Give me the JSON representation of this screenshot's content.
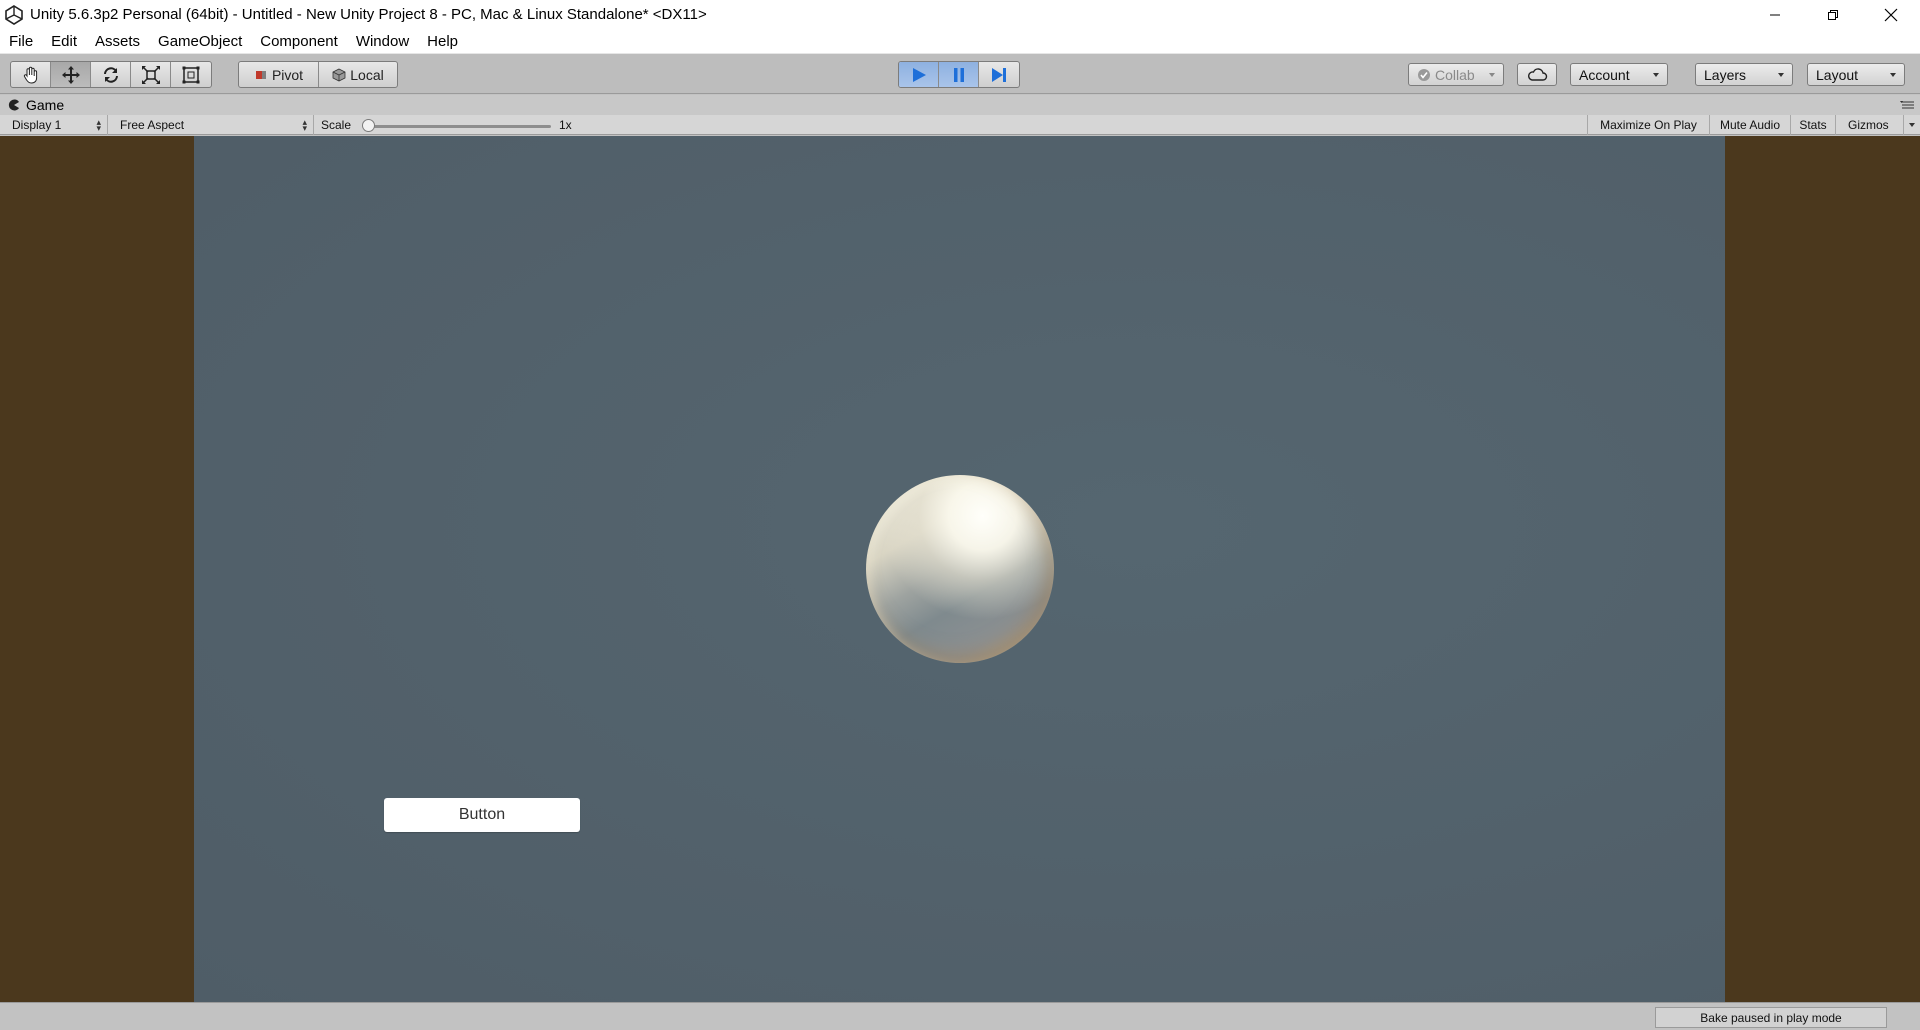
{
  "window": {
    "title": "Unity 5.6.3p2 Personal (64bit) - Untitled - New Unity Project 8 - PC, Mac & Linux Standalone* <DX11>"
  },
  "menu": {
    "items": [
      "File",
      "Edit",
      "Assets",
      "GameObject",
      "Component",
      "Window",
      "Help"
    ]
  },
  "toolbar": {
    "transform_tools": [
      "hand-icon",
      "move-icon",
      "rotate-icon",
      "scale-icon",
      "rect-icon"
    ],
    "pivot_label": "Pivot",
    "local_label": "Local",
    "collab_label": "Collab",
    "account_label": "Account",
    "layers_label": "Layers",
    "layout_label": "Layout",
    "play_color": "#1e6fd9"
  },
  "game_tab": {
    "label": "Game"
  },
  "game_toolbar": {
    "display": "Display 1",
    "aspect": "Free Aspect",
    "scale_label": "Scale",
    "scale_value": "1x",
    "maximize_on_play": "Maximize On Play",
    "mute_audio": "Mute Audio",
    "stats": "Stats",
    "gizmos": "Gizmos"
  },
  "scene": {
    "button_label": "Button",
    "letterbox_color": "#4b381d",
    "background_color": "#52616b"
  },
  "status": {
    "message": "Bake paused in play mode"
  }
}
